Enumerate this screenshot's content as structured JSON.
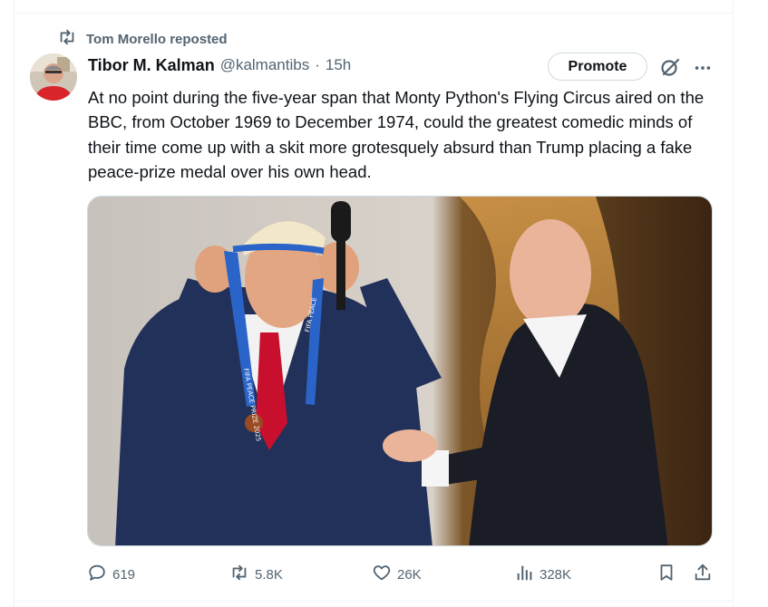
{
  "repost": {
    "label": "Tom Morello reposted",
    "icon": "repost-icon"
  },
  "tweet": {
    "author_name": "Tibor M. Kalman",
    "handle": "@kalmantibs",
    "separator": "·",
    "time": "15h",
    "promote_label": "Promote",
    "text": "At no point during the five-year span that Monty Python's Flying Circus aired on the BBC, from October 1969 to December 1974, could the greatest comedic minds of their time come up with a skit more grotesquely absurd than Trump placing a fake peace-prize medal over his own head."
  },
  "media": {
    "ribbon_text_1": "FIFA PEACE",
    "ribbon_text_2": "FIFA PEACE PRIZE 2025"
  },
  "actions": {
    "replies": "619",
    "reposts": "5.8K",
    "likes": "26K",
    "views": "328K"
  },
  "colors": {
    "text_primary": "#0f1419",
    "text_secondary": "#536471",
    "border": "#cfd9de"
  }
}
